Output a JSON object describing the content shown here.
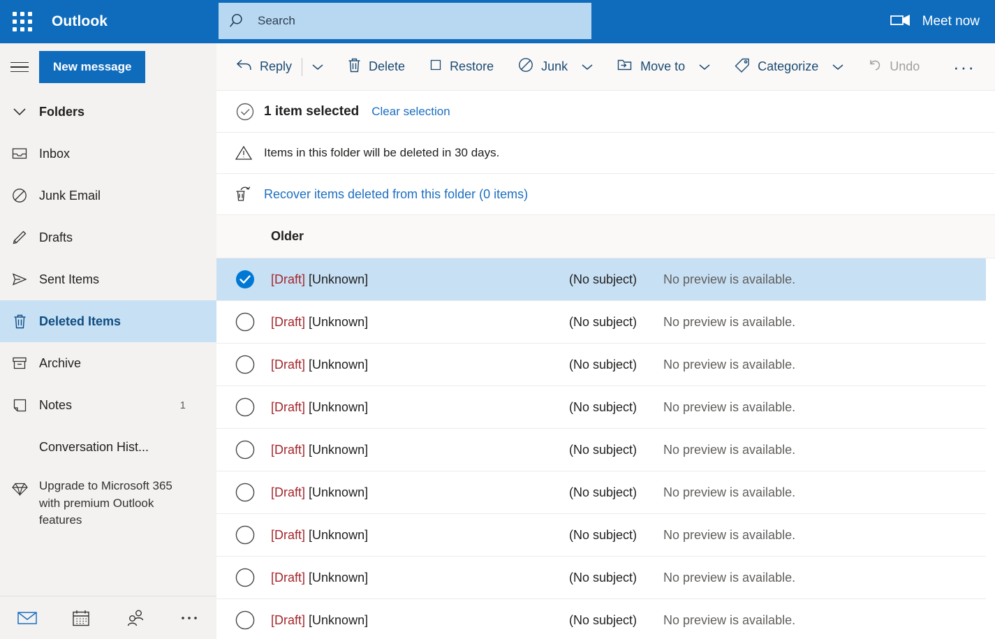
{
  "topbar": {
    "app_launcher": "app-launcher",
    "brand": "Outlook",
    "search_placeholder": "Search",
    "search_value": "",
    "meet_now": "Meet now"
  },
  "commandbar": {
    "new_message": "New message",
    "buttons": [
      {
        "label": "Reply",
        "icon": "reply-icon",
        "caret": true,
        "disabled": false
      },
      {
        "label": "Delete",
        "icon": "trash-icon",
        "caret": false,
        "disabled": false
      },
      {
        "label": "Restore",
        "icon": "restore-icon",
        "caret": false,
        "disabled": false
      },
      {
        "label": "Junk",
        "icon": "block-icon",
        "caret": true,
        "disabled": false
      },
      {
        "label": "Move to",
        "icon": "move-folder-icon",
        "caret": true,
        "disabled": false
      },
      {
        "label": "Categorize",
        "icon": "tag-icon",
        "caret": true,
        "disabled": false
      },
      {
        "label": "Undo",
        "icon": "undo-icon",
        "caret": false,
        "disabled": true
      }
    ],
    "overflow": "···"
  },
  "sidebar": {
    "folders_header": "Folders",
    "items": [
      {
        "label": "Inbox",
        "icon": "inbox-icon",
        "count": "",
        "active": false
      },
      {
        "label": "Junk Email",
        "icon": "block-icon",
        "count": "",
        "active": false
      },
      {
        "label": "Drafts",
        "icon": "pencil-icon",
        "count": "",
        "active": false
      },
      {
        "label": "Sent Items",
        "icon": "send-icon",
        "count": "",
        "active": false
      },
      {
        "label": "Deleted Items",
        "icon": "trash-icon",
        "count": "",
        "active": true
      },
      {
        "label": "Archive",
        "icon": "archive-icon",
        "count": "",
        "active": false
      },
      {
        "label": "Notes",
        "icon": "note-icon",
        "count": "1",
        "active": false
      },
      {
        "label": "Conversation Hist...",
        "icon": "",
        "count": "",
        "active": false
      }
    ],
    "upgrade": "Upgrade to Microsoft 365 with premium Outlook features",
    "footer": [
      {
        "name": "mail-icon"
      },
      {
        "name": "calendar-icon"
      },
      {
        "name": "people-icon"
      },
      {
        "name": "more-icon"
      }
    ]
  },
  "list": {
    "selection_text": "1 item selected",
    "clear_selection": "Clear selection",
    "notice": "Items in this folder will be deleted in 30 days.",
    "recover_link": "Recover items deleted from this folder (0 items)",
    "group_header": "Older",
    "rows": [
      {
        "draft": "[Draft]",
        "sender": "[Unknown]",
        "subject": "(No subject)",
        "preview": "No preview is available.",
        "selected": true
      },
      {
        "draft": "[Draft]",
        "sender": "[Unknown]",
        "subject": "(No subject)",
        "preview": "No preview is available.",
        "selected": false
      },
      {
        "draft": "[Draft]",
        "sender": "[Unknown]",
        "subject": "(No subject)",
        "preview": "No preview is available.",
        "selected": false
      },
      {
        "draft": "[Draft]",
        "sender": "[Unknown]",
        "subject": "(No subject)",
        "preview": "No preview is available.",
        "selected": false
      },
      {
        "draft": "[Draft]",
        "sender": "[Unknown]",
        "subject": "(No subject)",
        "preview": "No preview is available.",
        "selected": false
      },
      {
        "draft": "[Draft]",
        "sender": "[Unknown]",
        "subject": "(No subject)",
        "preview": "No preview is available.",
        "selected": false
      },
      {
        "draft": "[Draft]",
        "sender": "[Unknown]",
        "subject": "(No subject)",
        "preview": "No preview is available.",
        "selected": false
      },
      {
        "draft": "[Draft]",
        "sender": "[Unknown]",
        "subject": "(No subject)",
        "preview": "No preview is available.",
        "selected": false
      },
      {
        "draft": "[Draft]",
        "sender": "[Unknown]",
        "subject": "(No subject)",
        "preview": "No preview is available.",
        "selected": false
      }
    ]
  },
  "colors": {
    "brand_blue": "#0f6cbd",
    "search_bg": "#b8d7f0",
    "sidebar_bg": "#f3f2f1",
    "selected_row": "#c7e0f4",
    "link_blue": "#1b6ec2",
    "draft_red": "#a4262c",
    "command_text": "#1b4a73",
    "disabled_gray": "#a19f9d"
  }
}
